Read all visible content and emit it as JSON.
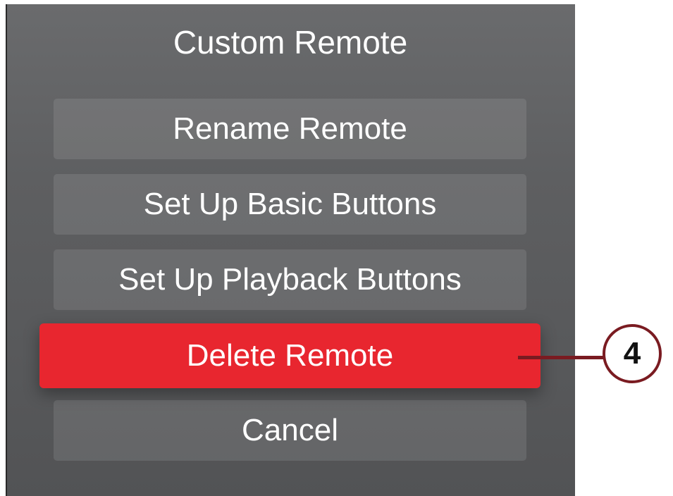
{
  "dialog": {
    "title": "Custom Remote",
    "buttons": [
      {
        "label": "Rename Remote"
      },
      {
        "label": "Set Up Basic Buttons"
      },
      {
        "label": "Set Up Playback Buttons"
      },
      {
        "label": "Delete Remote"
      },
      {
        "label": "Cancel"
      }
    ]
  },
  "callout": {
    "number": "4"
  },
  "colors": {
    "background": "#5e5f61",
    "danger": "#e8262f",
    "callout": "#7a1b21"
  }
}
